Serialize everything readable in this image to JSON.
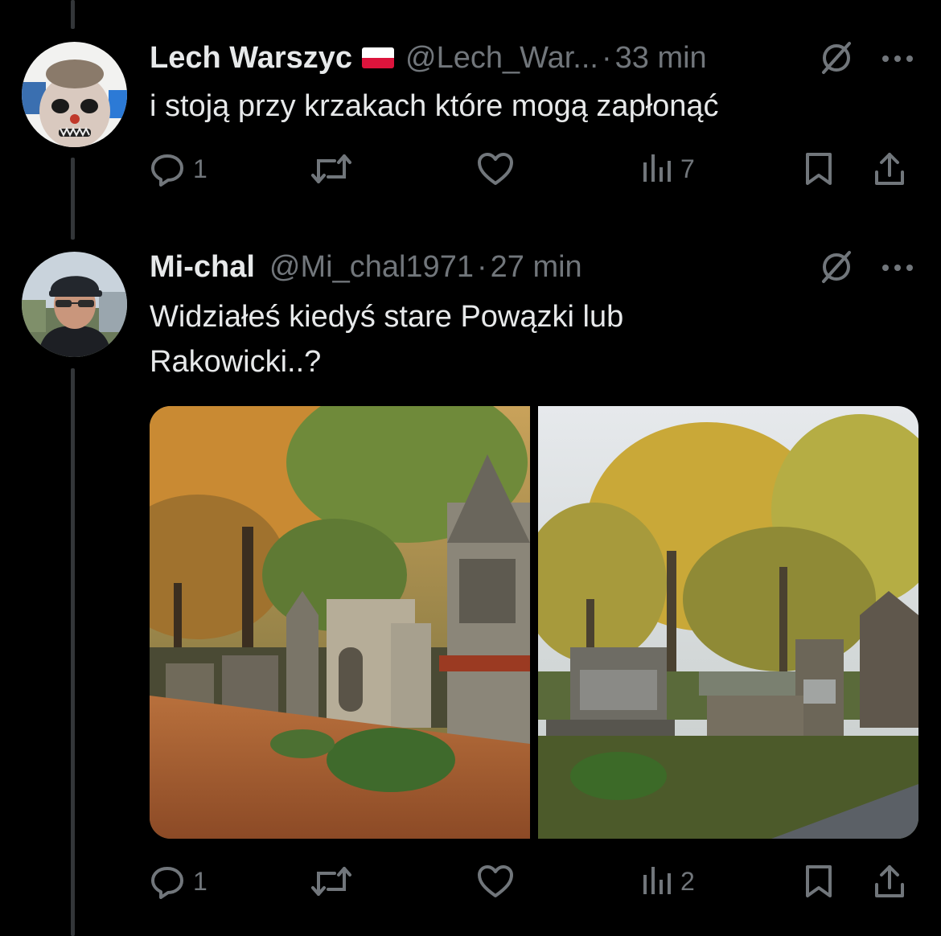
{
  "colors": {
    "background": "#000000",
    "text": "#e7e9ea",
    "muted": "#71767b",
    "thread_line": "#333639",
    "flag_white": "#ffffff",
    "flag_red": "#dc143c"
  },
  "posts": [
    {
      "name": "Lech Warszyc",
      "flag_icon": "poland-flag-icon",
      "handle": "@Lech_War...",
      "separator": "·",
      "time": "33 min",
      "text": "i  stoją przy krzakach które mogą zapłonąć",
      "reply_count": "1",
      "views_count": "7"
    },
    {
      "name": "Mi-chal",
      "handle": "@Mi_chal1971",
      "separator": "·",
      "time": "27 min",
      "text_line1": "Widziałeś kiedyś stare Powązki lub",
      "text_line2": "Rakowicki..?",
      "media_count": 2,
      "reply_count": "1",
      "views_count": "2"
    }
  ],
  "icons": [
    "grok-icon",
    "more-icon",
    "reply-icon",
    "repost-icon",
    "like-icon",
    "views-icon",
    "bookmark-icon",
    "share-icon"
  ]
}
